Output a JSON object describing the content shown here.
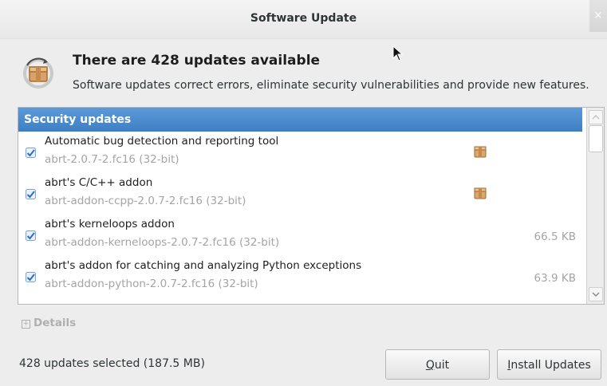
{
  "window": {
    "title": "Software Update",
    "close_glyph": "×"
  },
  "header": {
    "icon": "package-update-icon",
    "title": "There are 428 updates available",
    "subtitle": "Software updates correct errors, eliminate security vulnerabilities and provide new features."
  },
  "list": {
    "group_label": "Security updates",
    "items": [
      {
        "name": "Automatic bug detection and reporting tool",
        "package": "abrt-2.0.7-2.fc16 (32-bit)",
        "size": "",
        "checked": true,
        "icon": "package-icon"
      },
      {
        "name": "abrt's C/C++ addon",
        "package": "abrt-addon-ccpp-2.0.7-2.fc16 (32-bit)",
        "size": "",
        "checked": true,
        "icon": "package-icon"
      },
      {
        "name": "abrt's kerneloops addon",
        "package": "abrt-addon-kerneloops-2.0.7-2.fc16 (32-bit)",
        "size": "66.5 KB",
        "checked": true,
        "icon": ""
      },
      {
        "name": "abrt's addon for catching and analyzing Python exceptions",
        "package": "abrt-addon-python-2.0.7-2.fc16 (32-bit)",
        "size": "63.9 KB",
        "checked": true,
        "icon": ""
      }
    ]
  },
  "details": {
    "expander": "+",
    "label": "Details"
  },
  "footer": {
    "status": "428 updates selected (187.5 MB)",
    "quit_label_accel": "Q",
    "quit_label_rest": "uit",
    "install_label_accel": "I",
    "install_label_rest": "nstall Updates"
  },
  "colors": {
    "accent": "#4a8cce",
    "checkbox": "#3b7fd1",
    "muted_text": "#a4a4a4"
  }
}
